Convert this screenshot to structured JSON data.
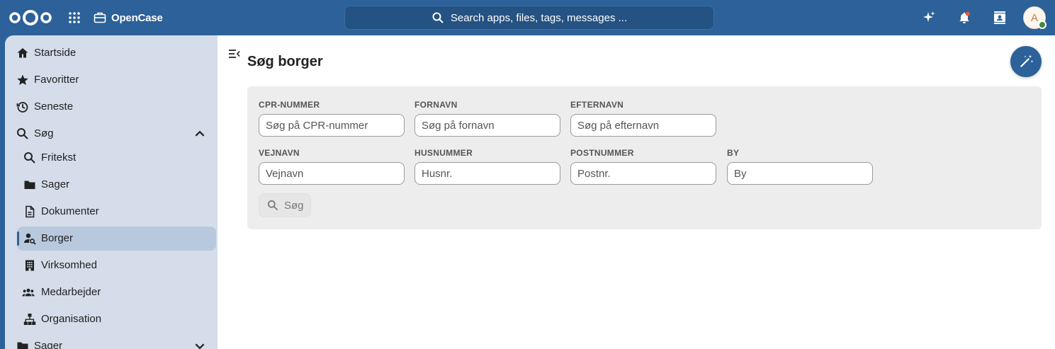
{
  "header": {
    "app_name": "OpenCase",
    "search_placeholder": "Search apps, files, tags, messages ...",
    "avatar_initial": "A",
    "colors": {
      "primary": "#2c6199",
      "status_online": "#3e8a3c",
      "notification": "#e05a3c"
    }
  },
  "sidebar": {
    "items": [
      {
        "label": "Startside",
        "icon": "home-icon"
      },
      {
        "label": "Favoritter",
        "icon": "star-icon"
      },
      {
        "label": "Seneste",
        "icon": "history-icon"
      },
      {
        "label": "Søg",
        "icon": "search-icon",
        "expanded": true
      },
      {
        "label": "Fritekst",
        "icon": "search-icon"
      },
      {
        "label": "Sager",
        "icon": "folder-icon"
      },
      {
        "label": "Dokumenter",
        "icon": "document-icon"
      },
      {
        "label": "Borger",
        "icon": "person-search-icon",
        "active": true
      },
      {
        "label": "Virksomhed",
        "icon": "building-icon"
      },
      {
        "label": "Medarbejder",
        "icon": "group-icon"
      },
      {
        "label": "Organisation",
        "icon": "sitemap-icon"
      },
      {
        "label": "Sager",
        "icon": "folder-icon",
        "expanded": false
      }
    ]
  },
  "main": {
    "title": "Søg borger",
    "fields": {
      "cpr": {
        "label": "CPR-NUMMER",
        "placeholder": "Søg på CPR-nummer"
      },
      "fornavn": {
        "label": "FORNAVN",
        "placeholder": "Søg på fornavn"
      },
      "efternavn": {
        "label": "EFTERNAVN",
        "placeholder": "Søg på efternavn"
      },
      "vejnavn": {
        "label": "VEJNAVN",
        "placeholder": "Vejnavn"
      },
      "husnummer": {
        "label": "HUSNUMMER",
        "placeholder": "Husnr."
      },
      "postnummer": {
        "label": "POSTNUMMER",
        "placeholder": "Postnr."
      },
      "by": {
        "label": "BY",
        "placeholder": "By"
      }
    },
    "search_button": "Søg"
  }
}
